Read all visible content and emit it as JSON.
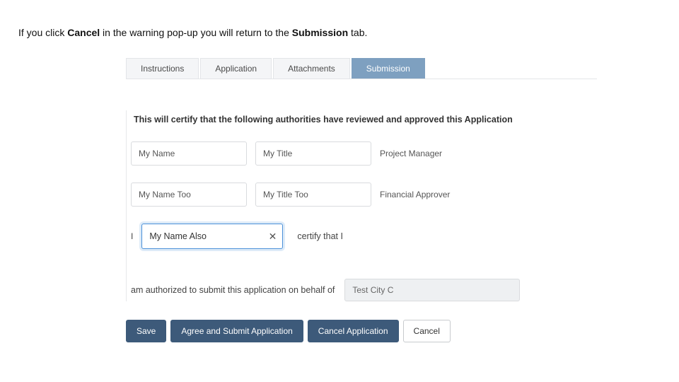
{
  "instruction": {
    "pre": "If you click ",
    "bold1": "Cancel",
    "mid": " in the warning pop-up you will return to the ",
    "bold2": "Submission",
    "post": " tab."
  },
  "tabs": {
    "instructions": "Instructions",
    "application": "Application",
    "attachments": "Attachments",
    "submission": "Submission"
  },
  "form": {
    "heading": "This will certify that the following authorities have reviewed and approved this Application",
    "row1": {
      "name": "My Name",
      "title": "My Title",
      "role": "Project Manager"
    },
    "row2": {
      "name": "My Name Too",
      "title": "My Title Too",
      "role": "Financial Approver"
    },
    "irow": {
      "i": "I",
      "name": "My Name Also",
      "suffix": "certify that I"
    },
    "auth": {
      "text": "am authorized to submit this application on behalf of",
      "org": "Test City C"
    }
  },
  "buttons": {
    "save": "Save",
    "agree": "Agree and Submit Application",
    "cancelApp": "Cancel Application",
    "cancel": "Cancel"
  }
}
